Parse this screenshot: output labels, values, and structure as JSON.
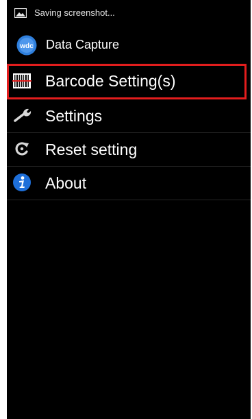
{
  "status_bar": {
    "icon": "image-icon",
    "text": "Saving screenshot..."
  },
  "action_bar": {
    "app_icon": "wdc-logo-icon",
    "app_icon_text": "wdc",
    "title": "Data Capture"
  },
  "menu": {
    "items": [
      {
        "label": "Barcode Setting(s)",
        "icon": "barcode-icon",
        "highlighted": true
      },
      {
        "label": "Settings",
        "icon": "wrench-icon"
      },
      {
        "label": "Reset setting",
        "icon": "reset-icon"
      },
      {
        "label": "About",
        "icon": "info-icon"
      }
    ]
  },
  "colors": {
    "background": "#000000",
    "highlight_border": "#e31d1d",
    "text": "#ffffff",
    "info_blue": "#1e6fd9"
  }
}
